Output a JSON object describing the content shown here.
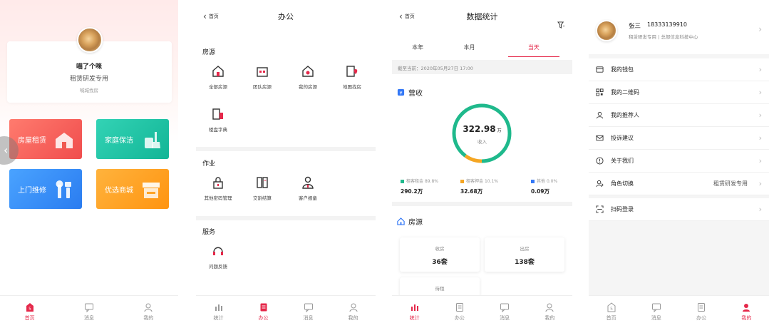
{
  "home": {
    "user_name": "喵了个咪",
    "role": "租赁研发专用",
    "subtitle": "喊城找房",
    "tiles": [
      "房屋租赁",
      "家庭保洁",
      "上门维修",
      "优选商城"
    ],
    "tabs": [
      "首页",
      "消息",
      "我的"
    ]
  },
  "office": {
    "back_label": "首页",
    "title": "办公",
    "sections": [
      {
        "title": "房源",
        "items": [
          "全部房源",
          "团队房源",
          "我的房源",
          "地图找房",
          "楼盘字典"
        ]
      },
      {
        "title": "作业",
        "items": [
          "其他密码管理",
          "交割结算",
          "客户报备"
        ]
      },
      {
        "title": "服务",
        "items": [
          "问题反馈"
        ]
      }
    ],
    "tabs": [
      "统计",
      "办公",
      "消息",
      "我的"
    ]
  },
  "stats": {
    "back_label": "首页",
    "title": "数据统计",
    "segments": [
      "本年",
      "本月",
      "当天"
    ],
    "deadline": "截至当前：2020年05月27日 17:00",
    "revenue_title": "营收",
    "total_value": "322.98",
    "total_unit": "万",
    "total_label": "收入",
    "legend": [
      {
        "name": "租客租金",
        "pct": "89.8%",
        "value": "290.2万",
        "color": "#1fb98c"
      },
      {
        "name": "租客押金",
        "pct": "10.1%",
        "value": "32.68万",
        "color": "#f5a623"
      },
      {
        "name": "其他",
        "pct": "0.0%",
        "value": "0.09万",
        "color": "#3478f6"
      }
    ],
    "source_title": "房源",
    "cards": [
      {
        "label": "收房",
        "value": "36套"
      },
      {
        "label": "出房",
        "value": "138套"
      },
      {
        "label": "待租",
        "value": ""
      }
    ],
    "tabs": [
      "统计",
      "办公",
      "消息",
      "我的"
    ]
  },
  "me": {
    "name": "张三",
    "phone": "18333139910",
    "org": "租赁研发专用 | 总部信息科技中心",
    "menu": [
      {
        "label": "我的钱包",
        "extra": ""
      },
      {
        "label": "我的二维码",
        "extra": ""
      },
      {
        "label": "我的推荐人",
        "extra": ""
      },
      {
        "label": "投诉建议",
        "extra": ""
      },
      {
        "label": "关于我们",
        "extra": ""
      },
      {
        "label": "角色切换",
        "extra": "租赁研发专用"
      }
    ],
    "scan_label": "扫码登录",
    "tabs": [
      "首页",
      "消息",
      "办公",
      "我的"
    ]
  }
}
